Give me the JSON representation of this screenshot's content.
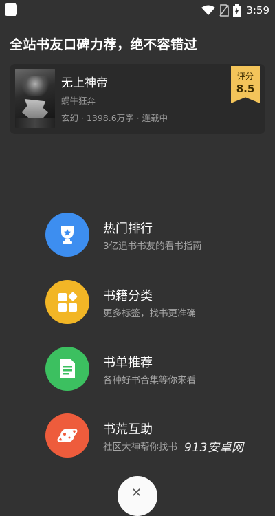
{
  "status_bar": {
    "time": "3:59",
    "icons": [
      "app-icon",
      "wifi-icon",
      "no-sim-icon",
      "battery-icon"
    ]
  },
  "promo": {
    "title": "全站书友口碑力荐，绝不容错过"
  },
  "book": {
    "name": "无上神帝",
    "author": "蜗牛狂奔",
    "meta": "玄幻 · 1398.6万字 · 连载中",
    "score_label": "评分",
    "score_value": "8.5"
  },
  "menu": [
    {
      "title": "热门排行",
      "subtitle": "3亿追书书友的看书指南",
      "icon": "trophy-icon",
      "color": "#3d8ef0"
    },
    {
      "title": "书籍分类",
      "subtitle": "更多标签，找书更准确",
      "icon": "category-grid-icon",
      "color": "#f2b626"
    },
    {
      "title": "书单推荐",
      "subtitle": "各种好书合集等你来看",
      "icon": "booklist-icon",
      "color": "#3cc060"
    },
    {
      "title": "书荒互助",
      "subtitle": "社区大神帮你找书",
      "icon": "planet-chat-icon",
      "color": "#ee5c3c"
    }
  ],
  "watermark": "913安卓网",
  "close_button": {
    "icon": "close-icon"
  }
}
